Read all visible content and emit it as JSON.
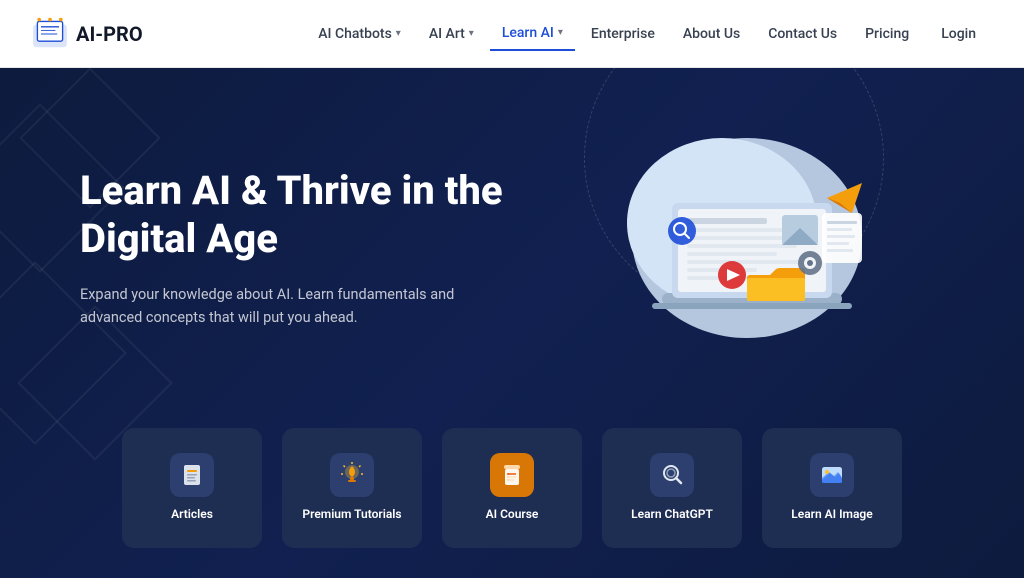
{
  "header": {
    "logo_text": "AI-PRO",
    "nav_items": [
      {
        "label": "AI Chatbots",
        "has_dropdown": true,
        "active": false
      },
      {
        "label": "AI Art",
        "has_dropdown": true,
        "active": false
      },
      {
        "label": "Learn AI",
        "has_dropdown": true,
        "active": true
      },
      {
        "label": "Enterprise",
        "has_dropdown": false,
        "active": false
      },
      {
        "label": "About Us",
        "has_dropdown": false,
        "active": false
      },
      {
        "label": "Contact Us",
        "has_dropdown": false,
        "active": false
      },
      {
        "label": "Pricing",
        "has_dropdown": false,
        "active": false
      },
      {
        "label": "Login",
        "has_dropdown": false,
        "active": false
      }
    ]
  },
  "hero": {
    "title": "Learn AI & Thrive in the Digital Age",
    "subtitle": "Expand your knowledge about AI. Learn fundamentals and advanced concepts that will put you ahead."
  },
  "cards": [
    {
      "label": "Articles",
      "icon": "📄",
      "icon_style": "default"
    },
    {
      "label": "Premium Tutorials",
      "icon": "💡",
      "icon_style": "amber"
    },
    {
      "label": "AI Course",
      "icon": "📋",
      "icon_style": "orange"
    },
    {
      "label": "Learn ChatGPT",
      "icon": "🔍",
      "icon_style": "default"
    },
    {
      "label": "Learn AI Image",
      "icon": "🖼️",
      "icon_style": "default"
    }
  ]
}
